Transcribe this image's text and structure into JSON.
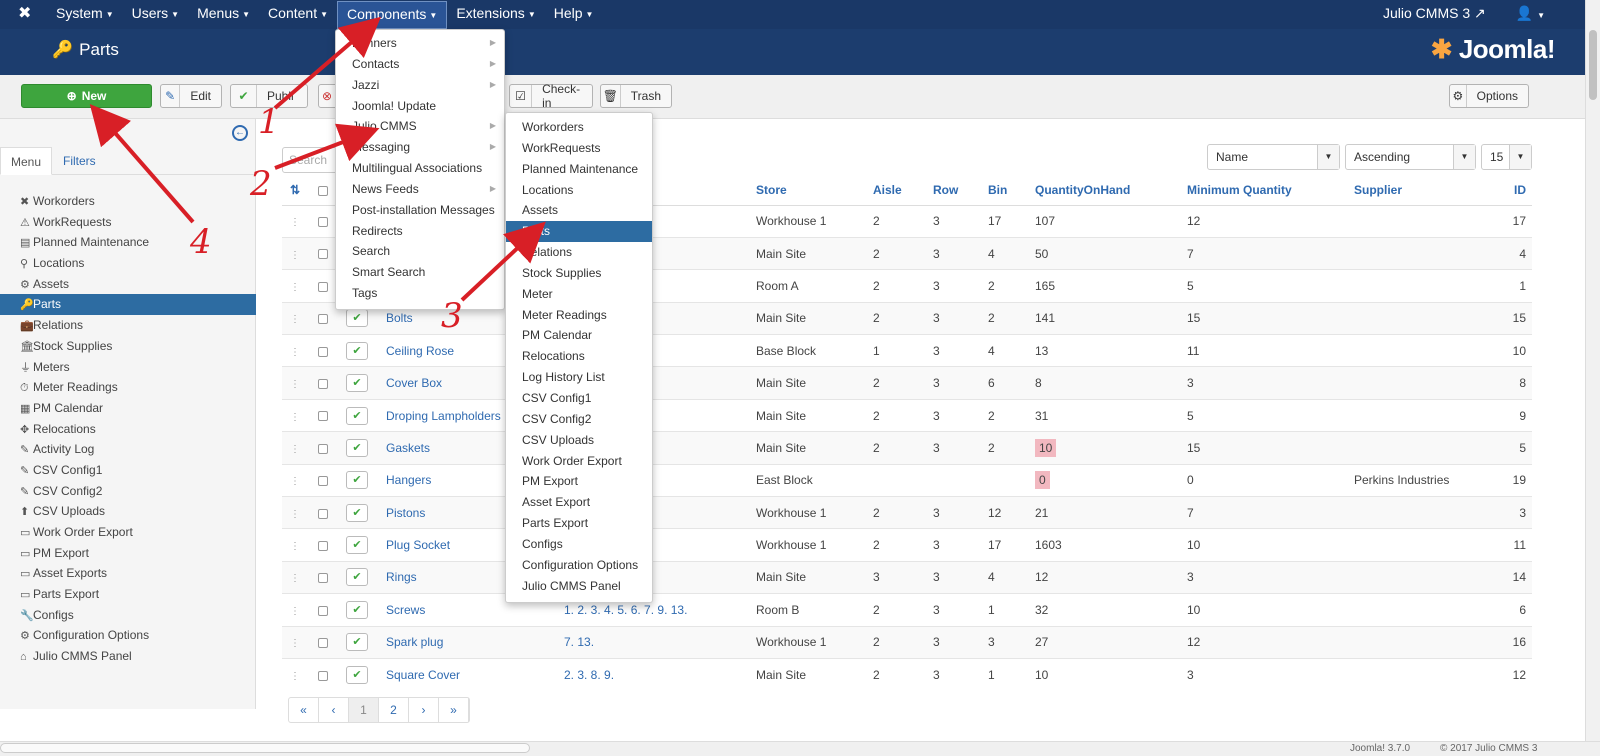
{
  "topnav": {
    "menu": [
      "System",
      "Users",
      "Menus",
      "Content",
      "Components",
      "Extensions",
      "Help"
    ],
    "user_site": "Julio CMMS 3",
    "user_icon": "user-icon"
  },
  "header": {
    "title": "Parts",
    "brand": "Joomla!"
  },
  "toolbar": {
    "new": "New",
    "edit": "Edit",
    "publish": "Publi",
    "checkin": "Check-in",
    "trash": "Trash",
    "options": "Options"
  },
  "sidebar": {
    "tabs": [
      "Menu",
      "Filters"
    ],
    "items": [
      "Workorders",
      "WorkRequests",
      "Planned Maintenance",
      "Locations",
      "Assets",
      "Parts",
      "Relations",
      "Stock Supplies",
      "Meters",
      "Meter Readings",
      "PM Calendar",
      "Relocations",
      "Activity Log",
      "CSV Config1",
      "CSV Config2",
      "CSV Uploads",
      "Work Order Export",
      "PM Export",
      "Asset Exports",
      "Parts Export",
      "Configs",
      "Configuration Options",
      "Julio CMMS Panel"
    ]
  },
  "filters": {
    "search_placeholder": "Search",
    "sort_field": "Name",
    "sort_dir": "Ascending",
    "limit": "15"
  },
  "table": {
    "headers": [
      "Store",
      "Aisle",
      "Row",
      "Bin",
      "QuantityOnHand",
      "Minimum Quantity",
      "Supplier",
      "ID"
    ],
    "rows": [
      {
        "name": "",
        "rel": "",
        "store": "Workhouse 1",
        "aisle": "2",
        "row": "3",
        "bin": "17",
        "qty": "107",
        "min": "12",
        "supplier": "",
        "id": "17",
        "low": false
      },
      {
        "name": "",
        "rel": "",
        "store": "Main Site",
        "aisle": "2",
        "row": "3",
        "bin": "4",
        "qty": "50",
        "min": "7",
        "supplier": "",
        "id": "4",
        "low": false
      },
      {
        "name": "",
        "rel": "",
        "store": "Room A",
        "aisle": "2",
        "row": "3",
        "bin": "2",
        "qty": "165",
        "min": "5",
        "supplier": "",
        "id": "1",
        "low": false
      },
      {
        "name": "Bolts",
        "rel": "",
        "store": "Main Site",
        "aisle": "2",
        "row": "3",
        "bin": "2",
        "qty": "141",
        "min": "15",
        "supplier": "",
        "id": "15",
        "low": false
      },
      {
        "name": "Ceiling Rose",
        "rel": "",
        "store": "Base Block",
        "aisle": "1",
        "row": "3",
        "bin": "4",
        "qty": "13",
        "min": "11",
        "supplier": "",
        "id": "10",
        "low": false
      },
      {
        "name": "Cover Box",
        "rel": "",
        "store": "Main Site",
        "aisle": "2",
        "row": "3",
        "bin": "6",
        "qty": "8",
        "min": "3",
        "supplier": "",
        "id": "8",
        "low": false
      },
      {
        "name": "Droping Lampholders",
        "rel": "",
        "store": "Main Site",
        "aisle": "2",
        "row": "3",
        "bin": "2",
        "qty": "31",
        "min": "5",
        "supplier": "",
        "id": "9",
        "low": false
      },
      {
        "name": "Gaskets",
        "rel": "",
        "store": "Main Site",
        "aisle": "2",
        "row": "3",
        "bin": "2",
        "qty": "10",
        "min": "15",
        "supplier": "",
        "id": "5",
        "low": true
      },
      {
        "name": "Hangers",
        "rel": "",
        "store": "East Block",
        "aisle": "",
        "row": "",
        "bin": "",
        "qty": "0",
        "min": "0",
        "supplier": "Perkins Industries",
        "id": "19",
        "low": true
      },
      {
        "name": "Pistons",
        "rel": "",
        "store": "Workhouse 1",
        "aisle": "2",
        "row": "3",
        "bin": "12",
        "qty": "21",
        "min": "7",
        "supplier": "",
        "id": "3",
        "low": false
      },
      {
        "name": "Plug Socket",
        "rel": "",
        "store": "Workhouse 1",
        "aisle": "2",
        "row": "3",
        "bin": "17",
        "qty": "1603",
        "min": "10",
        "supplier": "",
        "id": "11",
        "low": false
      },
      {
        "name": "Rings",
        "rel": "",
        "store": "Main Site",
        "aisle": "3",
        "row": "3",
        "bin": "4",
        "qty": "12",
        "min": "3",
        "supplier": "",
        "id": "14",
        "low": false
      },
      {
        "name": "Screws",
        "rel": "1. 2. 3. 4. 5. 6. 7. 9. 13.",
        "store": "Room B",
        "aisle": "2",
        "row": "3",
        "bin": "1",
        "qty": "32",
        "min": "10",
        "supplier": "",
        "id": "6",
        "low": false
      },
      {
        "name": "Spark plug",
        "rel": "7. 13.",
        "store": "Workhouse 1",
        "aisle": "2",
        "row": "3",
        "bin": "3",
        "qty": "27",
        "min": "12",
        "supplier": "",
        "id": "16",
        "low": false
      },
      {
        "name": "Square Cover",
        "rel": "2. 3. 8. 9.",
        "store": "Main Site",
        "aisle": "2",
        "row": "3",
        "bin": "1",
        "qty": "10",
        "min": "3",
        "supplier": "",
        "id": "12",
        "low": false
      }
    ]
  },
  "pagination": [
    "«",
    "‹",
    "1",
    "2",
    "›",
    "»"
  ],
  "components_menu": [
    {
      "label": "Banners",
      "sub": true
    },
    {
      "label": "Contacts",
      "sub": true
    },
    {
      "label": "Jazzi",
      "sub": true
    },
    {
      "label": "Joomla! Update",
      "sub": false
    },
    {
      "label": "Julio CMMS",
      "sub": true
    },
    {
      "label": "Messaging",
      "sub": true
    },
    {
      "label": "Multilingual Associations",
      "sub": false
    },
    {
      "label": "News Feeds",
      "sub": true
    },
    {
      "label": "Post-installation Messages",
      "sub": false
    },
    {
      "label": "Redirects",
      "sub": false
    },
    {
      "label": "Search",
      "sub": false
    },
    {
      "label": "Smart Search",
      "sub": false
    },
    {
      "label": "Tags",
      "sub": false
    }
  ],
  "julio_submenu": [
    "Workorders",
    "WorkRequests",
    "Planned Maintenance",
    "Locations",
    "Assets",
    "Parts",
    "Relations",
    "Stock Supplies",
    "Meter",
    "Meter Readings",
    "PM Calendar",
    "Relocations",
    "Log History List",
    "CSV Config1",
    "CSV Config2",
    "CSV Uploads",
    "Work Order Export",
    "PM Export",
    "Asset Export",
    "Parts Export",
    "Configs",
    "Configuration Options",
    "Julio CMMS Panel"
  ],
  "annotations": [
    "1",
    "2",
    "3",
    "4"
  ],
  "footer": {
    "version": "Joomla! 3.7.0",
    "copyright": "© 2017 Julio CMMS 3"
  },
  "colors": {
    "navbar": "#1a3867",
    "header": "#1c3d6e",
    "accent": "#2d6ca2",
    "new_button": "#3ea53e",
    "arrow": "#d81f26",
    "low_stock": "#f2b8c0"
  }
}
